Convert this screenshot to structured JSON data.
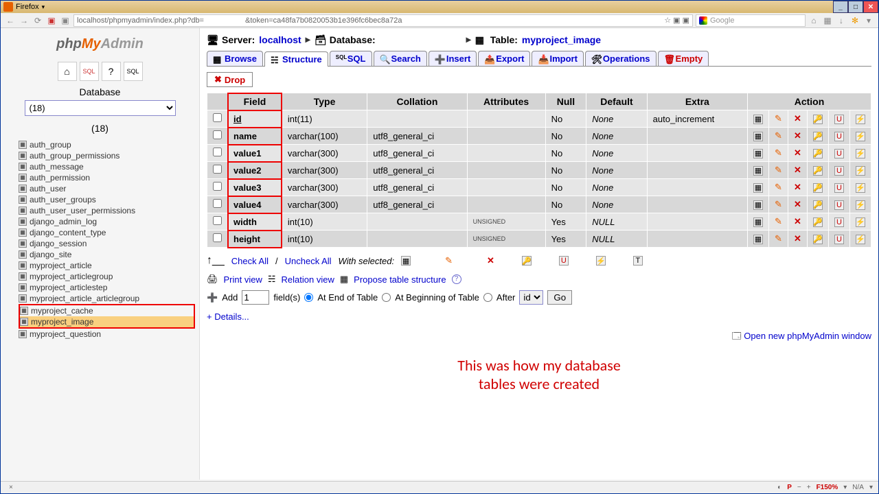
{
  "window": {
    "browser": "Firefox"
  },
  "urlbar": "localhost/phpmyadmin/index.php?db=",
  "urlbar_token": "&token=ca48fa7b0820053b1e396fc6bec8a72a",
  "search_placeholder": "Google",
  "sidebar": {
    "logo": {
      "php": "php",
      "my": "My",
      "admin": "Admin"
    },
    "db_label": "Database",
    "db_selected": "(18)",
    "db_count": "(18)",
    "tables": [
      "auth_group",
      "auth_group_permissions",
      "auth_message",
      "auth_permission",
      "auth_user",
      "auth_user_groups",
      "auth_user_user_permissions",
      "django_admin_log",
      "django_content_type",
      "django_session",
      "django_site",
      "myproject_article",
      "myproject_articlegroup",
      "myproject_articlestep",
      "myproject_article_articlegroup",
      "myproject_cache",
      "myproject_image",
      "myproject_question"
    ]
  },
  "breadcrumb": {
    "server_label": "Server:",
    "server": "localhost",
    "db_label": "Database:",
    "table_label": "Table:",
    "table": "myproject_image"
  },
  "tabs": {
    "browse": "Browse",
    "structure": "Structure",
    "sql": "SQL",
    "search": "Search",
    "insert": "Insert",
    "export": "Export",
    "import": "Import",
    "operations": "Operations",
    "empty": "Empty"
  },
  "drop_label": "Drop",
  "headers": {
    "field": "Field",
    "type": "Type",
    "collation": "Collation",
    "attributes": "Attributes",
    "null": "Null",
    "default": "Default",
    "extra": "Extra",
    "action": "Action"
  },
  "rows": [
    {
      "field": "id",
      "underline": true,
      "type": "int(11)",
      "collation": "",
      "attributes": "",
      "null": "No",
      "default": "None",
      "extra": "auto_increment"
    },
    {
      "field": "name",
      "type": "varchar(100)",
      "collation": "utf8_general_ci",
      "attributes": "",
      "null": "No",
      "default": "None",
      "extra": ""
    },
    {
      "field": "value1",
      "type": "varchar(300)",
      "collation": "utf8_general_ci",
      "attributes": "",
      "null": "No",
      "default": "None",
      "extra": ""
    },
    {
      "field": "value2",
      "type": "varchar(300)",
      "collation": "utf8_general_ci",
      "attributes": "",
      "null": "No",
      "default": "None",
      "extra": ""
    },
    {
      "field": "value3",
      "type": "varchar(300)",
      "collation": "utf8_general_ci",
      "attributes": "",
      "null": "No",
      "default": "None",
      "extra": ""
    },
    {
      "field": "value4",
      "type": "varchar(300)",
      "collation": "utf8_general_ci",
      "attributes": "",
      "null": "No",
      "default": "None",
      "extra": ""
    },
    {
      "field": "width",
      "type": "int(10)",
      "collation": "",
      "attributes": "UNSIGNED",
      "null": "Yes",
      "default": "NULL",
      "defitalic": true,
      "extra": ""
    },
    {
      "field": "height",
      "type": "int(10)",
      "collation": "",
      "attributes": "UNSIGNED",
      "null": "Yes",
      "default": "NULL",
      "defitalic": true,
      "extra": ""
    }
  ],
  "checkrow": {
    "checkall": "Check All",
    "uncheckall": "Uncheck All",
    "withselected": "With selected:"
  },
  "links": {
    "print": "Print view",
    "relation": "Relation view",
    "propose": "Propose table structure"
  },
  "add": {
    "add": "Add",
    "count": "1",
    "fields": "field(s)",
    "end": "At End of Table",
    "begin": "At Beginning of Table",
    "after": "After",
    "after_field": "id",
    "go": "Go"
  },
  "details": "+ Details...",
  "caption1": "This was how my database",
  "caption2": "tables were created",
  "footer": {
    "open": "Open new phpMyAdmin window"
  },
  "statusbar": {
    "zoom": "F150%",
    "p": "P",
    "na": "N/A"
  }
}
